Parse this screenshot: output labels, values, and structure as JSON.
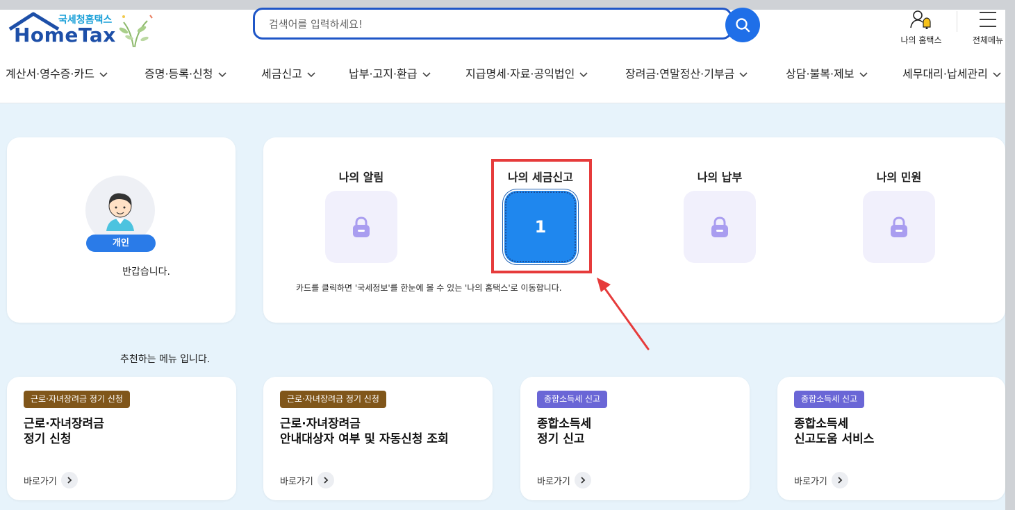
{
  "header": {
    "logo_sub": "국세청홈택스",
    "logo_main": "HomeTax",
    "search_placeholder": "검색어를 입력하세요!",
    "my_hometax": "나의 홈택스",
    "all_menu": "전체메뉴"
  },
  "nav": [
    {
      "label": "계산서·영수증·카드"
    },
    {
      "label": "증명·등록·신청"
    },
    {
      "label": "세금신고"
    },
    {
      "label": "납부·고지·환급"
    },
    {
      "label": "지급명세·자료·공익법인"
    },
    {
      "label": "장려금·연말정산·기부금"
    },
    {
      "label": "상담·불복·제보"
    },
    {
      "label": "세무대리·납세관리"
    }
  ],
  "profile": {
    "type_badge": "개인",
    "greeting": "반갑습니다."
  },
  "my_tiles": {
    "items": [
      {
        "title": "나의 알림",
        "state": "locked"
      },
      {
        "title": "나의 세금신고",
        "value": "1",
        "state": "active"
      },
      {
        "title": "나의 납부",
        "state": "locked"
      },
      {
        "title": "나의 민원",
        "state": "locked"
      }
    ],
    "note": "카드를 클릭하면 '국세정보'를 한눈에 볼 수 있는 '나의 홈택스'로 이동합니다."
  },
  "recommend": {
    "text": "추천하는 메뉴 입니다.",
    "cards": [
      {
        "badge": "근로·자녀장려금 정기 신청",
        "title1": "근로·자녀장려금",
        "title2": "정기 신청",
        "link": "바로가기",
        "badge_color": "#80561a"
      },
      {
        "badge": "근로·자녀장려금 정기 신청",
        "title1": "근로·자녀장려금",
        "title2": "안내대상자 여부 및 자동신청 조회",
        "link": "바로가기",
        "badge_color": "#80561a"
      },
      {
        "badge": "종합소득세 신고",
        "title1": "종합소득세",
        "title2": "정기 신고",
        "link": "바로가기",
        "badge_color": "#6a66d6"
      },
      {
        "badge": "종합소득세 신고",
        "title1": "종합소득세",
        "title2": "신고도움 서비스",
        "link": "바로가기",
        "badge_color": "#6a66d6"
      }
    ]
  },
  "colors": {
    "primary": "#1f56c7",
    "accent": "#1f87ee",
    "highlight": "#e63b3b",
    "background": "#e7f3fb"
  },
  "icons": [
    "search-icon",
    "user-bell-icon",
    "hamburger-menu-icon",
    "chevron-down-icon",
    "lock-icon",
    "thumbs-up-list-icon",
    "chevron-right-icon"
  ]
}
